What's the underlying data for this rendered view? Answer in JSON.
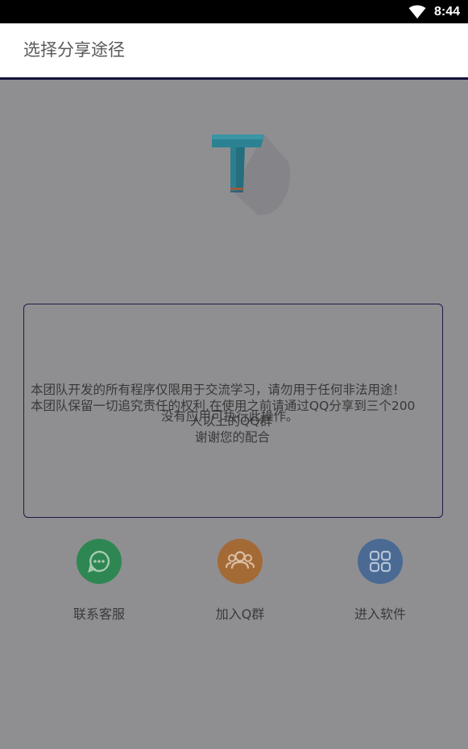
{
  "status_bar": {
    "time": "8:44",
    "wifi_icon": "wifi-icon"
  },
  "app_bar": {
    "title": "选择分享途径"
  },
  "logo": {
    "icon": "app-logo-icon",
    "accent": "#2a7a8a"
  },
  "notice": {
    "lines": [
      "本团队开发的所有程序仅限用于交流学习，请勿用于任何非法用途！",
      "本团队保留一切追究责任的权利,在使用之前请通过QQ分享到三个200",
      "没有应用可执行此操作。",
      "人以上的QQ群",
      "谢谢您的配合"
    ]
  },
  "actions": [
    {
      "label": "联系客服",
      "icon": "chat-bubble-icon",
      "color": "#2e8752"
    },
    {
      "label": "加入Q群",
      "icon": "group-users-icon",
      "color": "#a46a36"
    },
    {
      "label": "进入软件",
      "icon": "apps-grid-icon",
      "color": "#4a6a94"
    }
  ]
}
